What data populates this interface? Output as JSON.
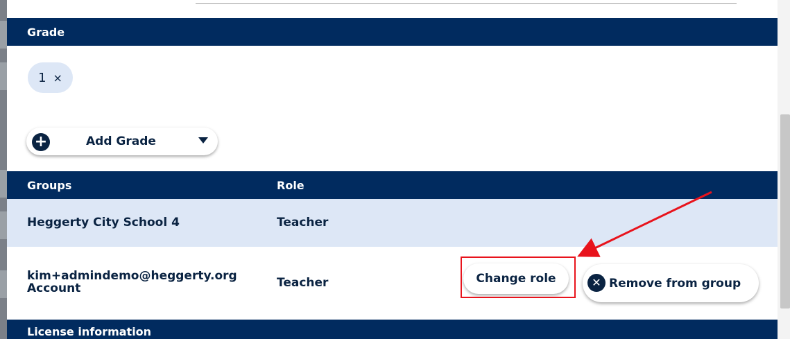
{
  "grade_section": {
    "header": "Grade",
    "chips": [
      {
        "label": "1",
        "remove_glyph": "×"
      }
    ],
    "add_button_label": "Add Grade",
    "add_icon": "plus-circle-icon",
    "dropdown_icon": "caret-down-icon"
  },
  "groups_table": {
    "columns": [
      "Groups",
      "Role"
    ],
    "rows": [
      {
        "group": "Heggerty City School 4",
        "role": "Teacher"
      },
      {
        "group_email": "kim+admindemo@heggerty.org",
        "group_sub": "Account",
        "role": "Teacher"
      }
    ],
    "change_role_label": "Change role",
    "remove_label": "Remove from group",
    "remove_icon": "x-circle-icon"
  },
  "license_section": {
    "header": "License information"
  },
  "annotation": {
    "highlight_color": "#e8131c"
  },
  "colors": {
    "navy": "#012b5f",
    "row_highlight": "#dde7f6",
    "text": "#0a2342"
  }
}
